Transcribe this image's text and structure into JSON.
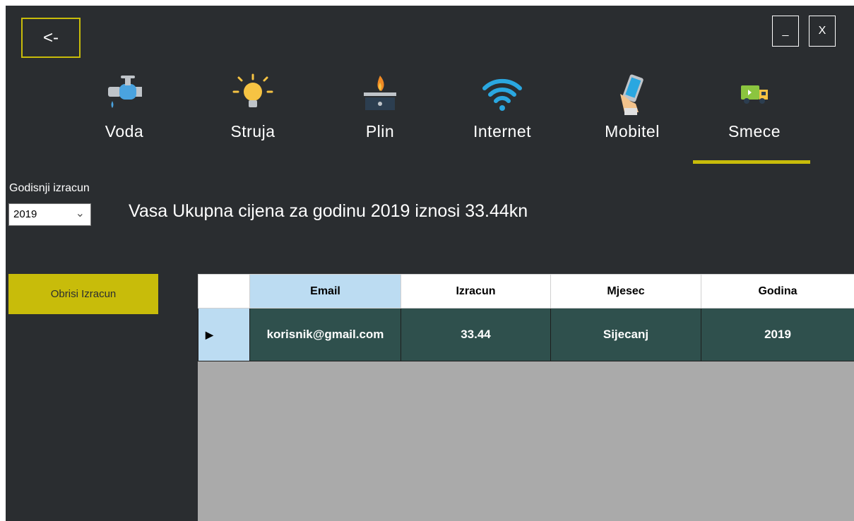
{
  "window": {
    "back_label": "<-",
    "minimize_label": "_",
    "close_label": "X"
  },
  "nav": {
    "items": [
      {
        "label": "Voda",
        "icon": "water-tap-icon"
      },
      {
        "label": "Struja",
        "icon": "light-bulb-icon"
      },
      {
        "label": "Plin",
        "icon": "gas-stove-icon"
      },
      {
        "label": "Internet",
        "icon": "wifi-icon"
      },
      {
        "label": "Mobitel",
        "icon": "mobile-phone-icon"
      },
      {
        "label": "Smece",
        "icon": "garbage-truck-icon"
      }
    ],
    "active": "Smece"
  },
  "year_filter": {
    "caption": "Godisnji izracun",
    "selected": "2019"
  },
  "summary": {
    "text": "Vasa Ukupna cijena za godinu 2019 iznosi 33.44kn"
  },
  "actions": {
    "delete_label": "Obrisi Izracun"
  },
  "table": {
    "columns": [
      "Email",
      "Izracun",
      "Mjesec",
      "Godina"
    ],
    "rows": [
      {
        "email": "korisnik@gmail.com",
        "izracun": "33.44",
        "mjesec": "Sijecanj",
        "godina": "2019"
      }
    ]
  },
  "colors": {
    "background": "#2a2d30",
    "accent": "#c8bc0a",
    "row": "#2f504d",
    "grid_empty": "#aaaaaa"
  }
}
